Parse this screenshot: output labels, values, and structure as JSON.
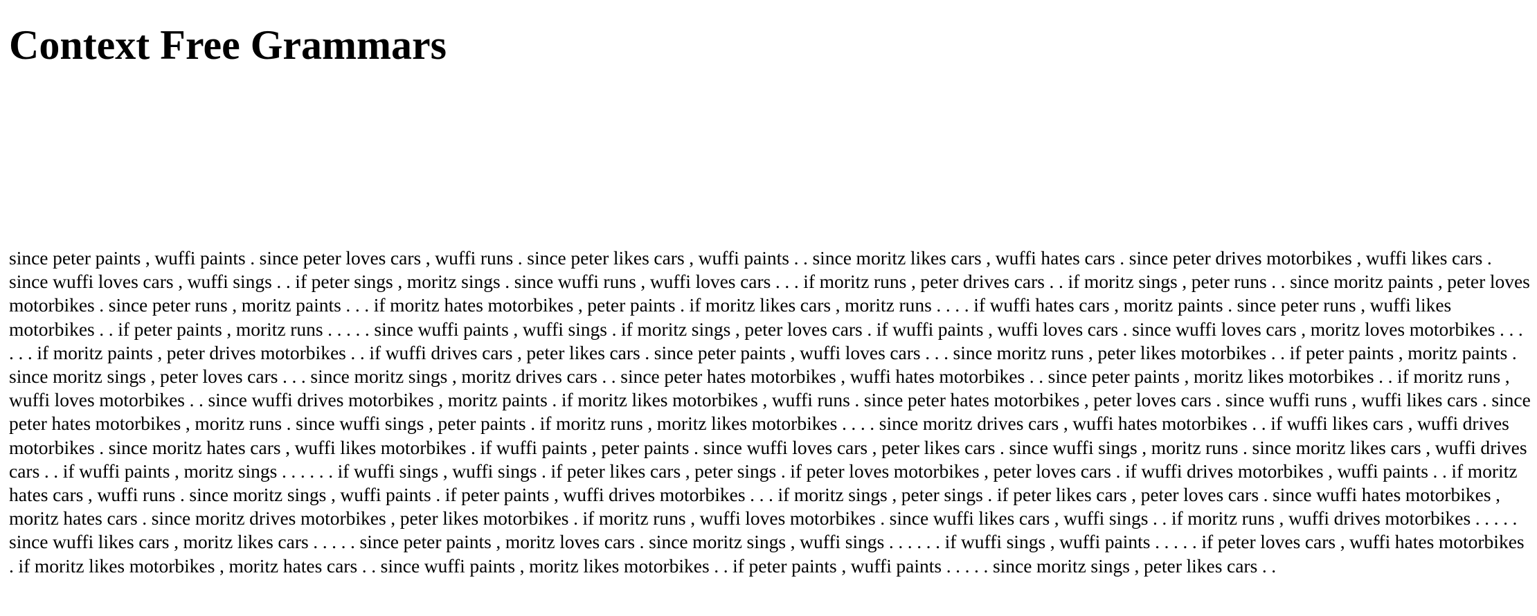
{
  "page": {
    "title": "Context Free Grammars",
    "generated_text": "since peter paints , wuffi paints . since peter loves cars , wuffi runs . since peter likes cars , wuffi paints . . since moritz likes cars , wuffi hates cars . since peter drives motorbikes , wuffi likes cars . since wuffi loves cars , wuffi sings . . if peter sings , moritz sings . since wuffi runs , wuffi loves cars . . . if moritz runs , peter drives cars . . if moritz sings , peter runs . . since moritz paints , peter loves motorbikes . since peter runs , moritz paints . . . if moritz hates motorbikes , peter paints . if moritz likes cars , moritz runs . . . . if wuffi hates cars , moritz paints . since peter runs , wuffi likes motorbikes . . if peter paints , moritz runs . . . . . since wuffi paints , wuffi sings . if moritz sings , peter loves cars . if wuffi paints , wuffi loves cars . since wuffi loves cars , moritz loves motorbikes . . . . . . if moritz paints , peter drives motorbikes . . if wuffi drives cars , peter likes cars . since peter paints , wuffi loves cars . . . since moritz runs , peter likes motorbikes . . if peter paints , moritz paints . since moritz sings , peter loves cars . . . since moritz sings , moritz drives cars . . since peter hates motorbikes , wuffi hates motorbikes . . since peter paints , moritz likes motorbikes . . if moritz runs , wuffi loves motorbikes . . since wuffi drives motorbikes , moritz paints . if moritz likes motorbikes , wuffi runs . since peter hates motorbikes , peter loves cars . since wuffi runs , wuffi likes cars . since peter hates motorbikes , moritz runs . since wuffi sings , peter paints . if moritz runs , moritz likes motorbikes . . . . since moritz drives cars , wuffi hates motorbikes . . if wuffi likes cars , wuffi drives motorbikes . since moritz hates cars , wuffi likes motorbikes . if wuffi paints , peter paints . since wuffi loves cars , peter likes cars . since wuffi sings , moritz runs . since moritz likes cars , wuffi drives cars . . if wuffi paints , moritz sings . . . . . . if wuffi sings , wuffi sings . if peter likes cars , peter sings . if peter loves motorbikes , peter loves cars . if wuffi drives motorbikes , wuffi paints . . if moritz hates cars , wuffi runs . since moritz sings , wuffi paints . if peter paints , wuffi drives motorbikes . . . if moritz sings , peter sings . if peter likes cars , peter loves cars . since wuffi hates motorbikes , moritz hates cars . since moritz drives motorbikes , peter likes motorbikes . if moritz runs , wuffi loves motorbikes . since wuffi likes cars , wuffi sings . . if moritz runs , wuffi drives motorbikes . . . . . since wuffi likes cars , moritz likes cars . . . . . since peter paints , moritz loves cars . since moritz sings , wuffi sings . . . . . . if wuffi sings , wuffi paints . . . . . if peter loves cars , wuffi hates motorbikes . if moritz likes motorbikes , moritz hates cars . . since wuffi paints , moritz likes motorbikes . . if peter paints , wuffi paints . . . . . since moritz sings , peter likes cars . ."
  }
}
